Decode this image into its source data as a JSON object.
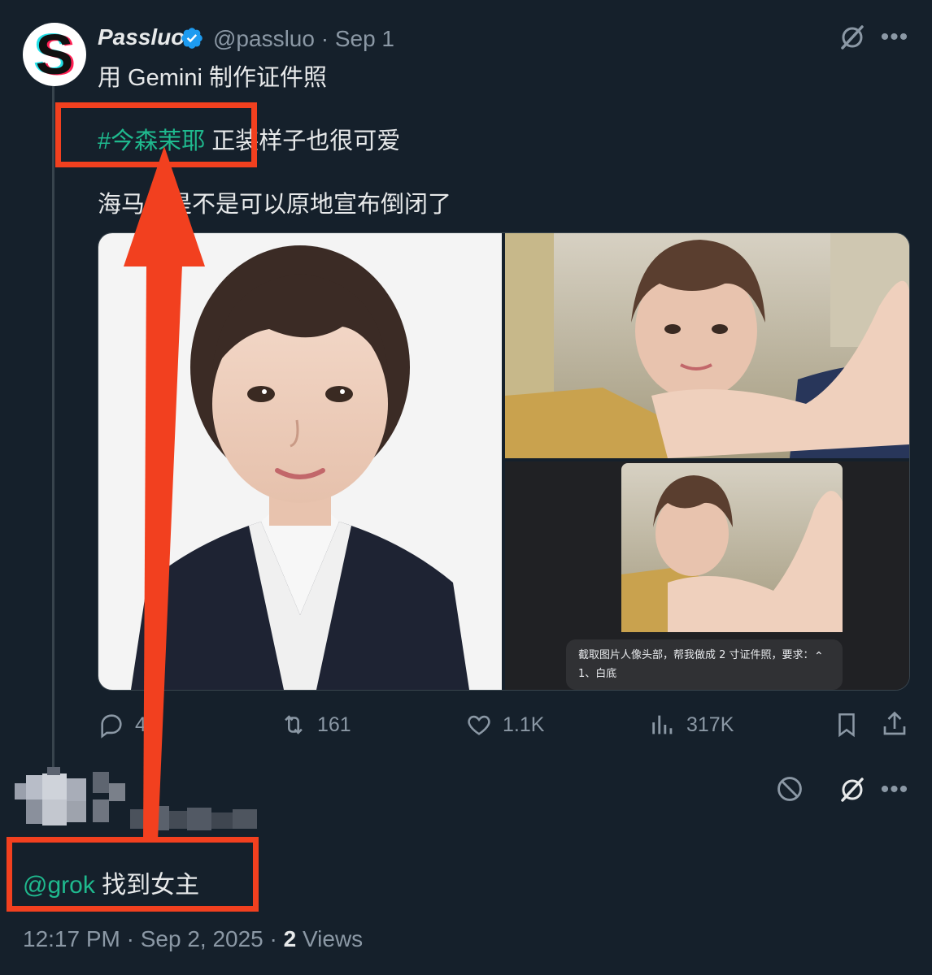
{
  "tweet": {
    "display_name": "Passluo",
    "handle": "@passluo",
    "date": "Sep 1",
    "handle_date": "@passluo · Sep 1",
    "line1": "用 Gemini 制作证件照",
    "hashtag": "#今森茉耶",
    "line2_rest": " 正装样子也很可爱",
    "line3": "海马体是不是可以原地宣布倒闭了",
    "media": {
      "prompt_line1": "截取图片人像头部，帮我做成 2 寸证件照，要求：",
      "prompt_line2": "1、白底"
    },
    "actions": {
      "replies": "4",
      "retweets": "161",
      "likes": "1.1K",
      "views": "317K"
    }
  },
  "reply": {
    "mention": "@grok",
    "text": " 找到女主",
    "time": "12:17 PM · Sep 2, 2025 · ",
    "views_count": "2",
    "views_label": " Views"
  },
  "icons": {
    "verified": "verified-badge-icon",
    "grok": "grok-icon",
    "more": "more-icon",
    "reply": "reply-icon",
    "retweet": "retweet-icon",
    "like": "like-icon",
    "views": "views-icon",
    "bookmark": "bookmark-icon",
    "share": "share-icon",
    "block": "block-icon"
  },
  "colors": {
    "background": "#15202b",
    "hashtag": "#1fb98e",
    "annotation": "#f2401f",
    "verified": "#1d9bf0"
  }
}
